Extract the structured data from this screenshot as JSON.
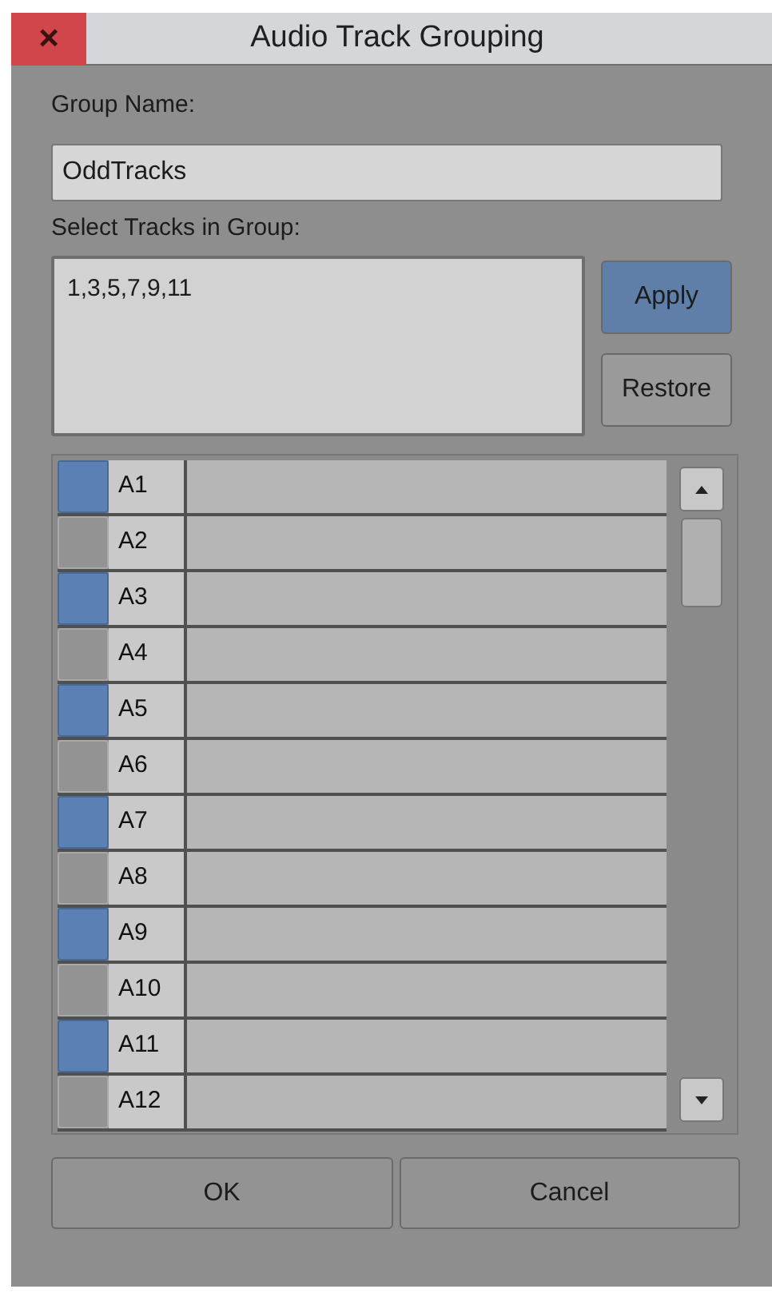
{
  "window": {
    "title": "Audio Track Grouping",
    "close": "×"
  },
  "group_name": {
    "label": "Group Name:",
    "value": "OddTracks"
  },
  "tracks_field": {
    "label": "Select Tracks in Group:",
    "value": "1,3,5,7,9,11"
  },
  "side_buttons": [
    {
      "label": "Apply",
      "kind": "primary"
    },
    {
      "label": "Restore",
      "kind": "normal"
    }
  ],
  "tracks": [
    {
      "name": "A1",
      "checked": true
    },
    {
      "name": "A2",
      "checked": false
    },
    {
      "name": "A3",
      "checked": true
    },
    {
      "name": "A4",
      "checked": false
    },
    {
      "name": "A5",
      "checked": true
    },
    {
      "name": "A6",
      "checked": false
    },
    {
      "name": "A7",
      "checked": true
    },
    {
      "name": "A8",
      "checked": false
    },
    {
      "name": "A9",
      "checked": true
    },
    {
      "name": "A10",
      "checked": false
    },
    {
      "name": "A11",
      "checked": true
    },
    {
      "name": "A12",
      "checked": false
    }
  ],
  "buttons": [
    "OK",
    "Cancel"
  ]
}
